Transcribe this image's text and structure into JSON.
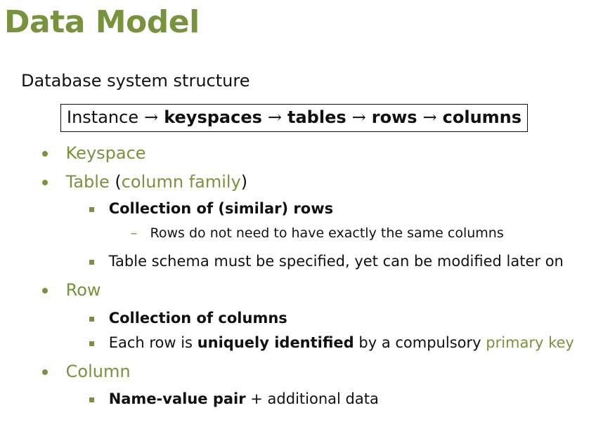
{
  "title": "Data Model",
  "subtitle": "Database system structure",
  "structure_box": {
    "parts": [
      "Instance",
      "keyspaces",
      "tables",
      "rows",
      "columns"
    ],
    "arrow": "→"
  },
  "items": {
    "keyspace": "Keyspace",
    "table": "Table",
    "table_paren_open": "(",
    "table_alias": "column family",
    "table_paren_close": ")",
    "table_sub1": "Collection of (similar) rows",
    "table_sub1_detail": "Rows do not need to have exactly the same columns",
    "table_sub2": "Table schema must be specified, yet can be modified later on",
    "row": "Row",
    "row_sub1": "Collection of columns",
    "row_sub2_a": "Each row is ",
    "row_sub2_b": "uniquely identified",
    "row_sub2_c": " by a compulsory ",
    "row_sub2_d": "primary key",
    "column": "Column",
    "column_sub1_a": "Name-value pair",
    "column_sub1_b": " + additional data"
  },
  "colors": {
    "accent": "#77933c",
    "text": "#111111"
  }
}
